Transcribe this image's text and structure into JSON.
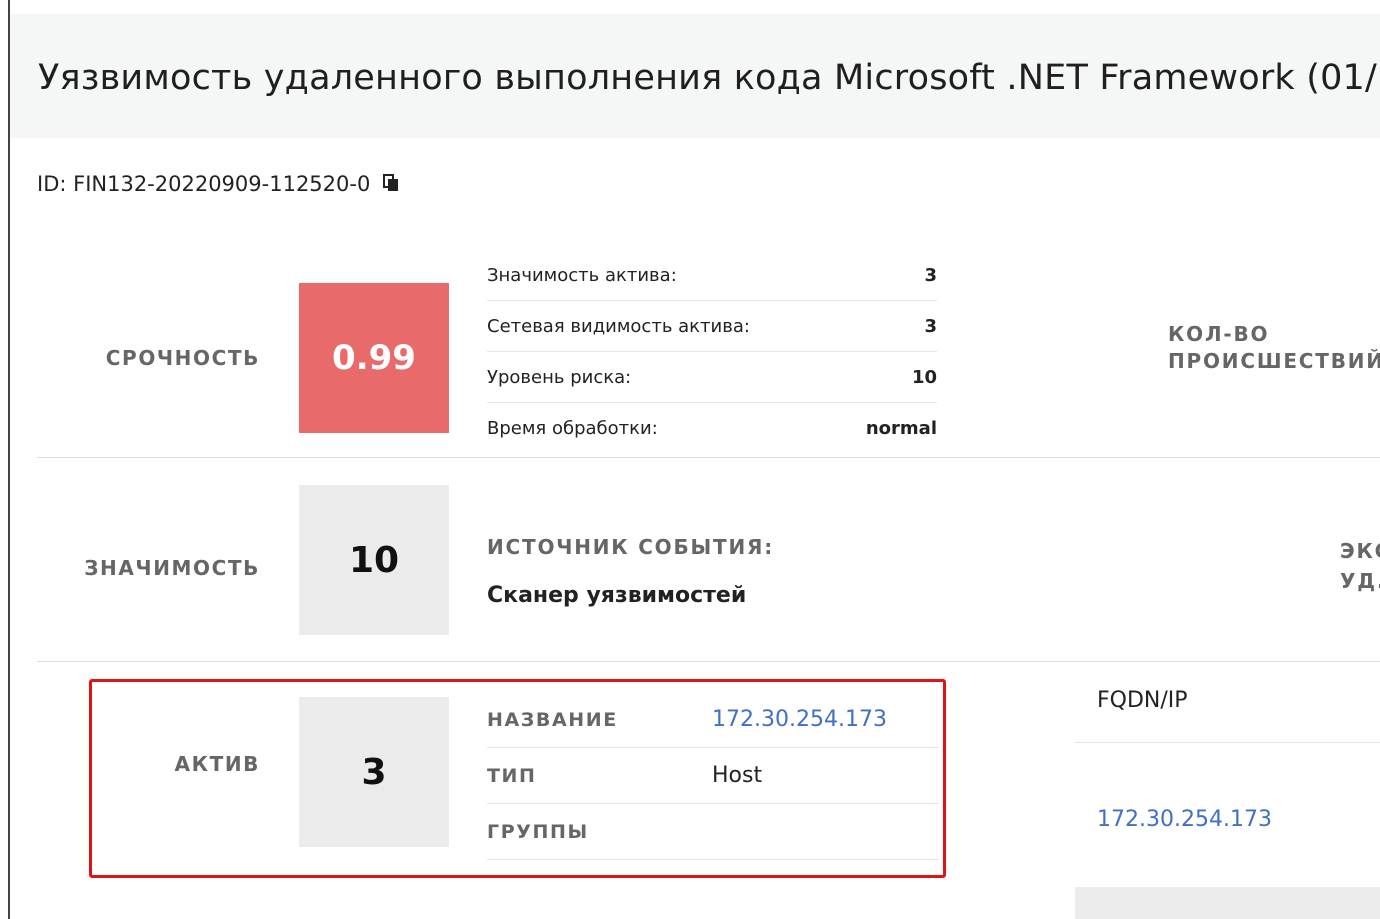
{
  "title": "Уязвимость удаленного выполнения кода Microsoft .NET Framework (01/",
  "id_text": "ID: FIN132-20220909-112520-0",
  "rows": {
    "urgency": {
      "label": "СРОЧНОСТЬ",
      "score": "0.99",
      "color": "#e86a6a"
    },
    "significance": {
      "label": "ЗНАЧИМОСТЬ",
      "score": "10"
    },
    "asset": {
      "label": "АКТИВ",
      "score": "3"
    }
  },
  "metrics": [
    {
      "label": "Значимость актива:",
      "value": "3"
    },
    {
      "label": "Сетевая видимость актива:",
      "value": "3"
    },
    {
      "label": "Уровень риска:",
      "value": "10"
    },
    {
      "label": "Время обработки:",
      "value": "normal"
    }
  ],
  "incidents": {
    "label_line1": "КОЛ-ВО",
    "label_line2": "ПРОИСШЕСТВИЙ"
  },
  "source": {
    "label": "ИСТОЧНИК СОБЫТИЯ:",
    "value": "Сканер уязвимостей"
  },
  "exploit": {
    "label_line1": "ЭКС",
    "label_line2": "УД."
  },
  "asset_table": [
    {
      "key": "НАЗВАНИЕ",
      "value": "172.30.254.173",
      "link": true
    },
    {
      "key": "ТИП",
      "value": "Host",
      "link": false
    },
    {
      "key": "ГРУППЫ",
      "value": "",
      "link": false
    }
  ],
  "fqdn": {
    "label": "FQDN/IP",
    "value": "172.30.254.173"
  },
  "colors": {
    "link": "#3f6fc7",
    "highlight_border": "#e01414"
  }
}
